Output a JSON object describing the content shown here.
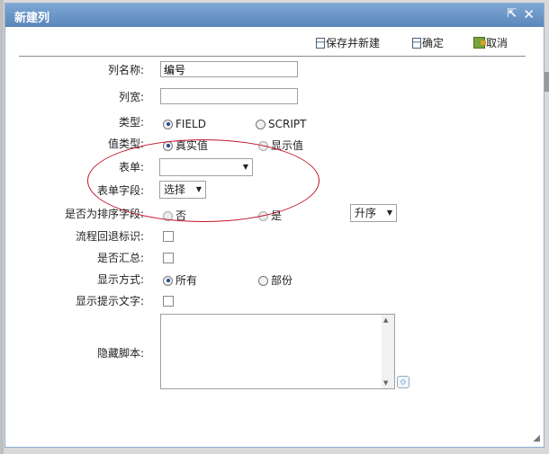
{
  "dialog": {
    "title": "新建列",
    "toolbar": {
      "save_new_label": "保存并新建",
      "confirm_label": "确定",
      "cancel_label": "取消"
    },
    "fields": {
      "column_name": {
        "label": "列名称:",
        "value": "编号"
      },
      "column_width": {
        "label": "列宽:",
        "value": ""
      },
      "type": {
        "label": "类型:",
        "options": [
          "FIELD",
          "SCRIPT"
        ],
        "selected": "FIELD"
      },
      "value_type": {
        "label": "值类型:",
        "options": [
          "真实值",
          "显示值"
        ],
        "selected": "真实值"
      },
      "form": {
        "label": "表单:",
        "value": ""
      },
      "form_field": {
        "label": "表单字段:",
        "value": "选择"
      },
      "sort_field": {
        "label": "是否为排序字段:",
        "options": [
          "否",
          "是"
        ],
        "selected": "否",
        "order_value": "升序"
      },
      "flow_rollback": {
        "label": "流程回退标识:",
        "checked": false
      },
      "summary": {
        "label": "是否汇总:",
        "checked": false
      },
      "display_mode": {
        "label": "显示方式:",
        "options": [
          "所有",
          "部份"
        ],
        "selected": "所有"
      },
      "show_tip": {
        "label": "显示提示文字:",
        "checked": false
      },
      "hidden_script": {
        "label": "隐藏脚本:",
        "value": ""
      }
    }
  },
  "colors": {
    "titlebar_start": "#7ea7d4",
    "titlebar_end": "#5a86bb",
    "highlight_circle": "#c0152a"
  }
}
